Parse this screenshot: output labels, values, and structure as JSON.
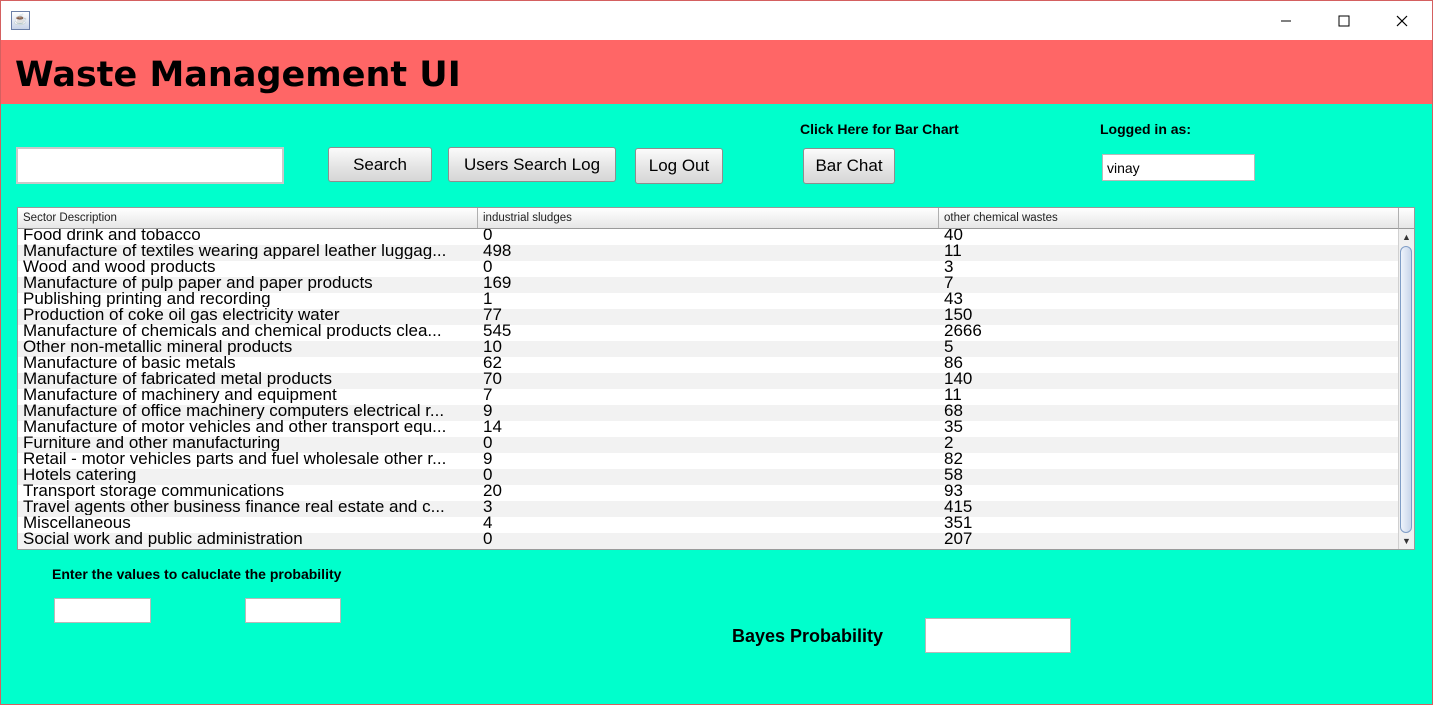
{
  "window": {
    "icon": "java-icon",
    "controls": [
      "minimize-icon",
      "maximize-icon",
      "close-icon"
    ]
  },
  "header": {
    "title": "Waste Management UI",
    "color": "#ff6666"
  },
  "background_color": "#00ffcc",
  "toolbar": {
    "search_value": "",
    "search_label": "Search",
    "users_log_label": "Users Search Log",
    "logout_label": "Log Out",
    "bar_chart_hint": "Click Here for Bar Chart",
    "bar_chart_label": "Bar Chat",
    "logged_in_label": "Logged in as:",
    "logged_in_user": "vinay"
  },
  "table": {
    "columns": [
      "Sector Description",
      "industrial sludges",
      "other chemical wastes"
    ],
    "rows": [
      [
        "Food drink and tobacco",
        "0",
        "40"
      ],
      [
        "Manufacture of textiles wearing apparel leather luggag...",
        "498",
        "11"
      ],
      [
        "Wood and wood products",
        "0",
        "3"
      ],
      [
        "Manufacture of pulp paper and paper products",
        "169",
        "7"
      ],
      [
        "Publishing printing and recording",
        "1",
        "43"
      ],
      [
        "Production of coke oil gas electricity water",
        "77",
        "150"
      ],
      [
        "Manufacture of chemicals and chemical products clea...",
        "545",
        "2666"
      ],
      [
        "Other non-metallic mineral products",
        "10",
        "5"
      ],
      [
        "Manufacture of basic metals",
        "62",
        "86"
      ],
      [
        "Manufacture of fabricated metal products",
        "70",
        "140"
      ],
      [
        "Manufacture of machinery and equipment",
        "7",
        "11"
      ],
      [
        "Manufacture of office machinery computers electrical r...",
        "9",
        "68"
      ],
      [
        "Manufacture of motor vehicles and other transport equ...",
        "14",
        "35"
      ],
      [
        "Furniture and other manufacturing",
        "0",
        "2"
      ],
      [
        "Retail - motor vehicles parts and fuel wholesale other r...",
        "9",
        "82"
      ],
      [
        "Hotels catering",
        "0",
        "58"
      ],
      [
        "Transport storage communications",
        "20",
        "93"
      ],
      [
        "Travel agents other business finance real estate and c...",
        "3",
        "415"
      ],
      [
        "Miscellaneous",
        "4",
        "351"
      ],
      [
        "Social work and public administration",
        "0",
        "207"
      ]
    ]
  },
  "probability": {
    "prompt": "Enter the values to caluclate the probability",
    "value1": "",
    "value2": "",
    "bayes_label": "Bayes Probability",
    "bayes_value": ""
  }
}
